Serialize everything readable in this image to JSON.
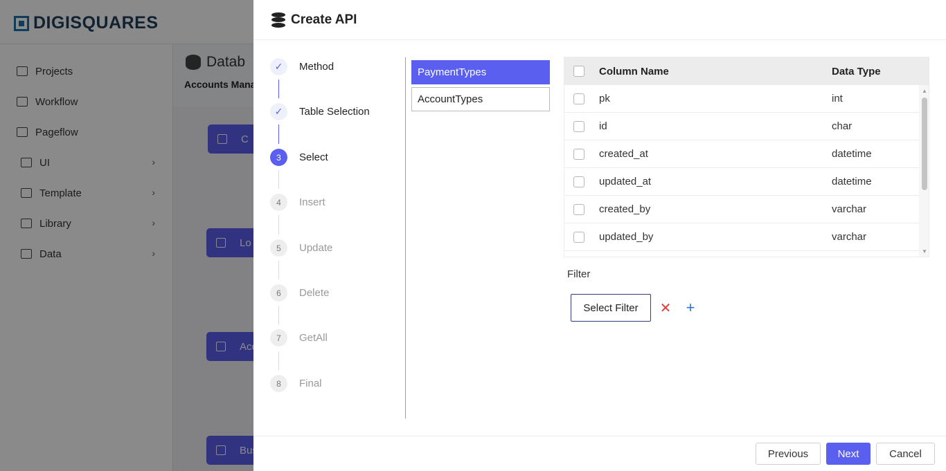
{
  "app": {
    "logo_text": "DIGISQUARES"
  },
  "sidebar": {
    "items": [
      {
        "label": "Projects",
        "icon": "folder-icon"
      },
      {
        "label": "Workflow",
        "icon": "workflow-icon"
      },
      {
        "label": "Pageflow",
        "icon": "document-icon"
      },
      {
        "label": "UI",
        "icon": "grid-icon"
      },
      {
        "label": "Template",
        "icon": "template-icon"
      },
      {
        "label": "Library",
        "icon": "library-icon"
      },
      {
        "label": "Data",
        "icon": "data-icon"
      }
    ]
  },
  "background": {
    "title": "Datab",
    "subtitle": "Accounts Mana",
    "cards": [
      "C",
      "Lo",
      "Acc",
      "Bus"
    ]
  },
  "drawer": {
    "title": "Create API",
    "steps": [
      {
        "marker": "✓",
        "label": "Method",
        "state": "done"
      },
      {
        "marker": "✓",
        "label": "Table Selection",
        "state": "done"
      },
      {
        "marker": "3",
        "label": "Select",
        "state": "active"
      },
      {
        "marker": "4",
        "label": "Insert",
        "state": "todo"
      },
      {
        "marker": "5",
        "label": "Update",
        "state": "todo"
      },
      {
        "marker": "6",
        "label": "Delete",
        "state": "todo"
      },
      {
        "marker": "7",
        "label": "GetAll",
        "state": "todo"
      },
      {
        "marker": "8",
        "label": "Final",
        "state": "todo"
      }
    ],
    "tables": [
      {
        "label": "PaymentTypes",
        "selected": true
      },
      {
        "label": "AccountTypes",
        "selected": false
      }
    ],
    "grid": {
      "headers": {
        "name": "Column Name",
        "type": "Data Type"
      },
      "rows": [
        {
          "name": "pk",
          "type": "int"
        },
        {
          "name": "id",
          "type": "char"
        },
        {
          "name": "created_at",
          "type": "datetime"
        },
        {
          "name": "updated_at",
          "type": "datetime"
        },
        {
          "name": "created_by",
          "type": "varchar"
        },
        {
          "name": "updated_by",
          "type": "varchar"
        }
      ]
    },
    "filter": {
      "label": "Filter",
      "select_label": "Select Filter",
      "remove_glyph": "✕",
      "add_glyph": "+"
    },
    "footer": {
      "previous": "Previous",
      "next": "Next",
      "cancel": "Cancel"
    }
  },
  "colors": {
    "accent": "#5b5fef",
    "danger": "#e03a3a",
    "add": "#2b74d4"
  }
}
